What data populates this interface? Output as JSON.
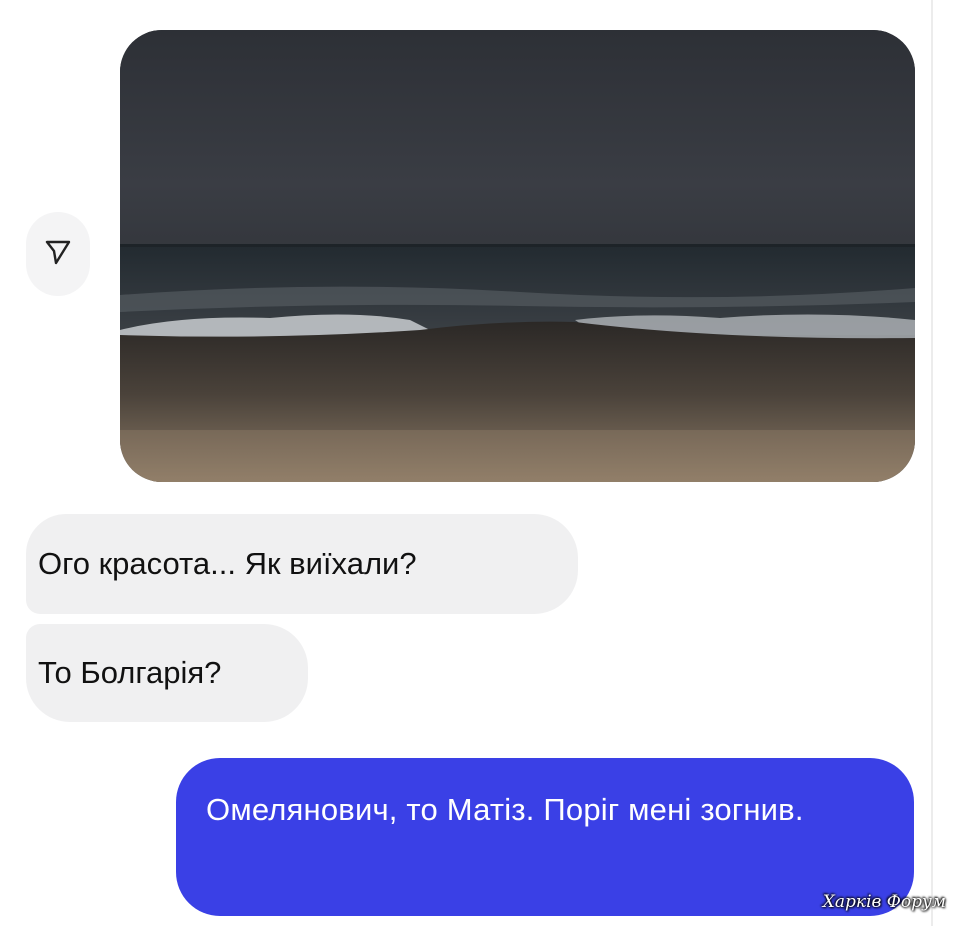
{
  "conversation": {
    "image_message": {
      "alt": "",
      "share_icon": "send-arrow-icon"
    },
    "incoming": [
      {
        "text": "Ого красота... Як виїхали?"
      },
      {
        "text": "То Болгарія?"
      }
    ],
    "outgoing": [
      {
        "text": "Омелянович, то Матіз. Поріг мені зогнив."
      }
    ],
    "colors": {
      "outgoing_bubble": "#3a40e6",
      "incoming_bubble": "#f0f0f1",
      "background": "#ffffff"
    }
  },
  "watermark": {
    "text": "Харків Форум"
  }
}
